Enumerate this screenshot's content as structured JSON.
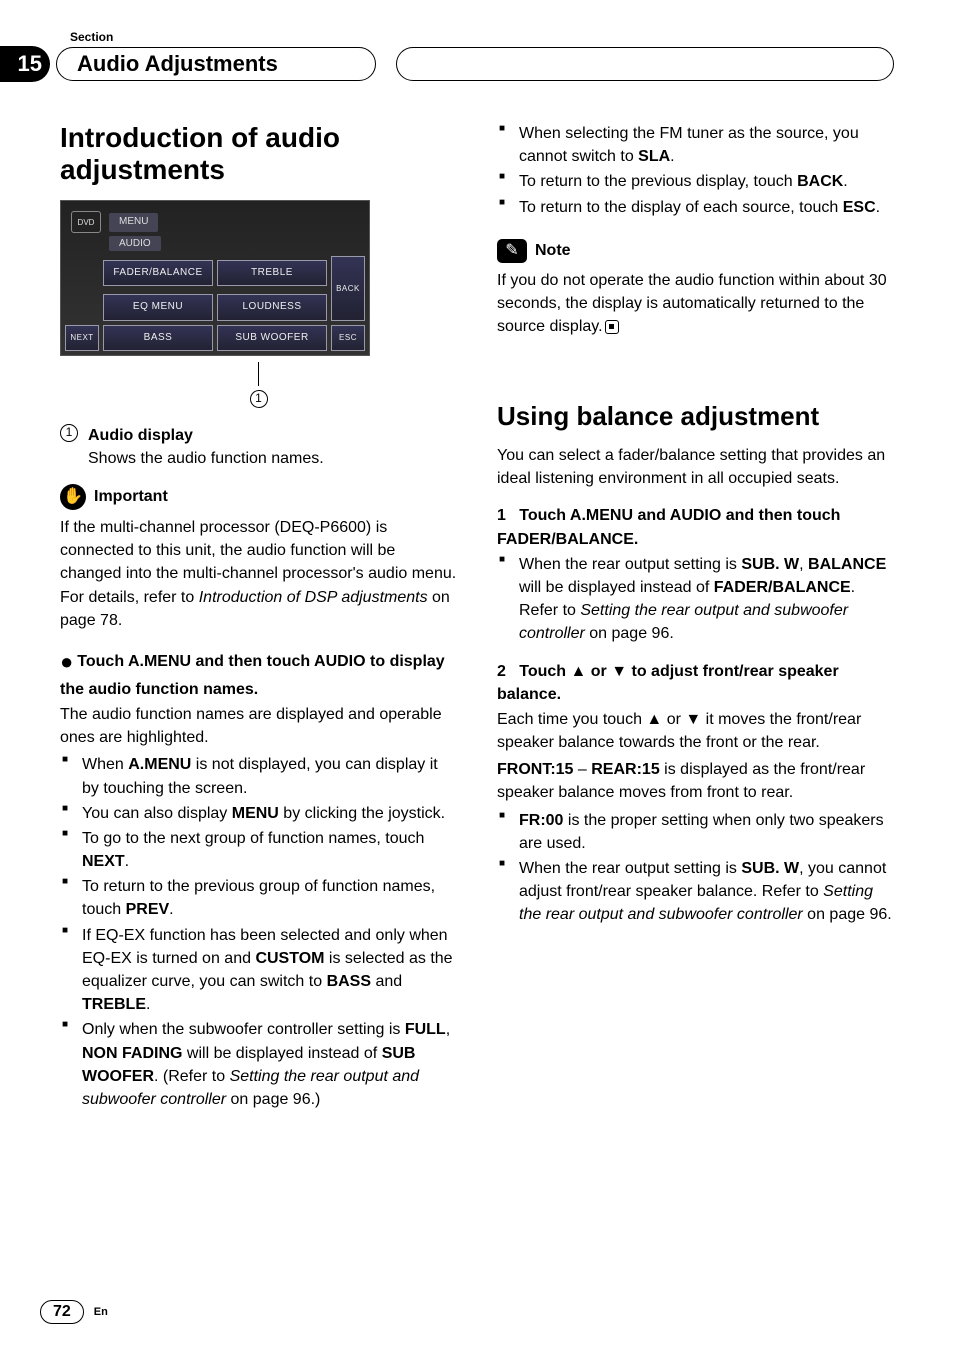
{
  "header": {
    "section_label": "Section",
    "section_number": "15",
    "title": "Audio Adjustments"
  },
  "left": {
    "h1": "Introduction of audio adjustments",
    "screenshot": {
      "top_menu": "MENU",
      "audio_label": "AUDIO",
      "buttons": {
        "fader": "FADER/BALANCE",
        "treble": "TREBLE",
        "eqmenu": "EQ MENU",
        "loudness": "LOUDNESS",
        "bass": "BASS",
        "subwoofer": "SUB WOOFER",
        "next": "NEXT",
        "back": "BACK",
        "esc": "ESC"
      },
      "pointer_num": "1"
    },
    "item1_num": "1",
    "item1_label": "Audio display",
    "item1_desc": "Shows the audio function names.",
    "important_label": "Important",
    "important_body_1": "If the multi-channel processor (DEQ-P6600) is connected to this unit, the audio function will be changed into the multi-channel processor's audio menu. For details, refer to ",
    "important_body_italic": "Introduction of DSP adjustments",
    "important_body_2": " on page 78.",
    "step1": "Touch A.MENU and then touch AUDIO to display the audio function names.",
    "step1_body": "The audio function names are displayed and operable ones are highlighted.",
    "bul1_a": "When ",
    "bul1_b": "A.MENU",
    "bul1_c": " is not displayed, you can display it by touching the screen.",
    "bul2_a": "You can also display ",
    "bul2_b": "MENU",
    "bul2_c": " by clicking the joystick.",
    "bul3_a": "To go to the next group of function names, touch ",
    "bul3_b": "NEXT",
    "bul3_c": ".",
    "bul4_a": "To return to the previous group of function names, touch ",
    "bul4_b": "PREV",
    "bul4_c": ".",
    "bul5_a": "If EQ-EX function has been selected and only when EQ-EX is turned on and ",
    "bul5_b": "CUSTOM",
    "bul5_c": " is selected as the equalizer curve, you can switch to ",
    "bul5_d": "BASS",
    "bul5_e": " and ",
    "bul5_f": "TREBLE",
    "bul5_g": ".",
    "bul6_a": "Only when the subwoofer controller setting is ",
    "bul6_b": "FULL",
    "bul6_c": ", ",
    "bul6_d": "NON FADING",
    "bul6_e": " will be displayed instead of ",
    "bul6_f": "SUB WOOFER",
    "bul6_g": ". (Refer to ",
    "bul6_h": "Setting the rear output and subwoofer controller",
    "bul6_i": " on page 96.)"
  },
  "right": {
    "bul7_a": "When selecting the FM tuner as the source, you cannot switch to ",
    "bul7_b": "SLA",
    "bul7_c": ".",
    "bul8_a": "To return to the previous display, touch ",
    "bul8_b": "BACK",
    "bul8_c": ".",
    "bul9_a": "To return to the display of each source, touch ",
    "bul9_b": "ESC",
    "bul9_c": ".",
    "note_label": "Note",
    "note_body": "If you do not operate the audio function within about 30 seconds, the display is automatically returned to the source display.",
    "h1": "Using balance adjustment",
    "intro": "You can select a fader/balance setting that provides an ideal listening environment in all occupied seats.",
    "step1_num": "1",
    "step1": "Touch A.MENU and AUDIO and then touch FADER/BALANCE.",
    "s1b1_a": "When the rear output setting is ",
    "s1b1_b": "SUB. W",
    "s1b1_c": ", ",
    "s1b1_d": "BALANCE",
    "s1b1_e": " will be displayed instead of ",
    "s1b1_f": "FADER/BALANCE",
    "s1b1_g": ". Refer to ",
    "s1b1_h": "Setting the rear output and subwoofer controller",
    "s1b1_i": " on page 96.",
    "step2_num": "2",
    "step2": "Touch ▲ or ▼ to adjust front/rear speaker balance.",
    "s2_body": "Each time you touch ▲ or ▼ it moves the front/rear speaker balance towards the front or the rear.",
    "s2_range_a": "FRONT:15",
    "s2_range_mid": " – ",
    "s2_range_b": "REAR:15",
    "s2_range_c": " is displayed as the front/rear speaker balance moves from front to rear.",
    "s2b1_a": "FR:00",
    "s2b1_b": " is the proper setting when only two speakers are used.",
    "s2b2_a": "When the rear output setting is ",
    "s2b2_b": "SUB. W",
    "s2b2_c": ", you cannot adjust front/rear speaker balance. Refer to ",
    "s2b2_d": "Setting the rear output and subwoofer controller",
    "s2b2_e": " on page 96."
  },
  "footer": {
    "page": "72",
    "lang": "En"
  }
}
